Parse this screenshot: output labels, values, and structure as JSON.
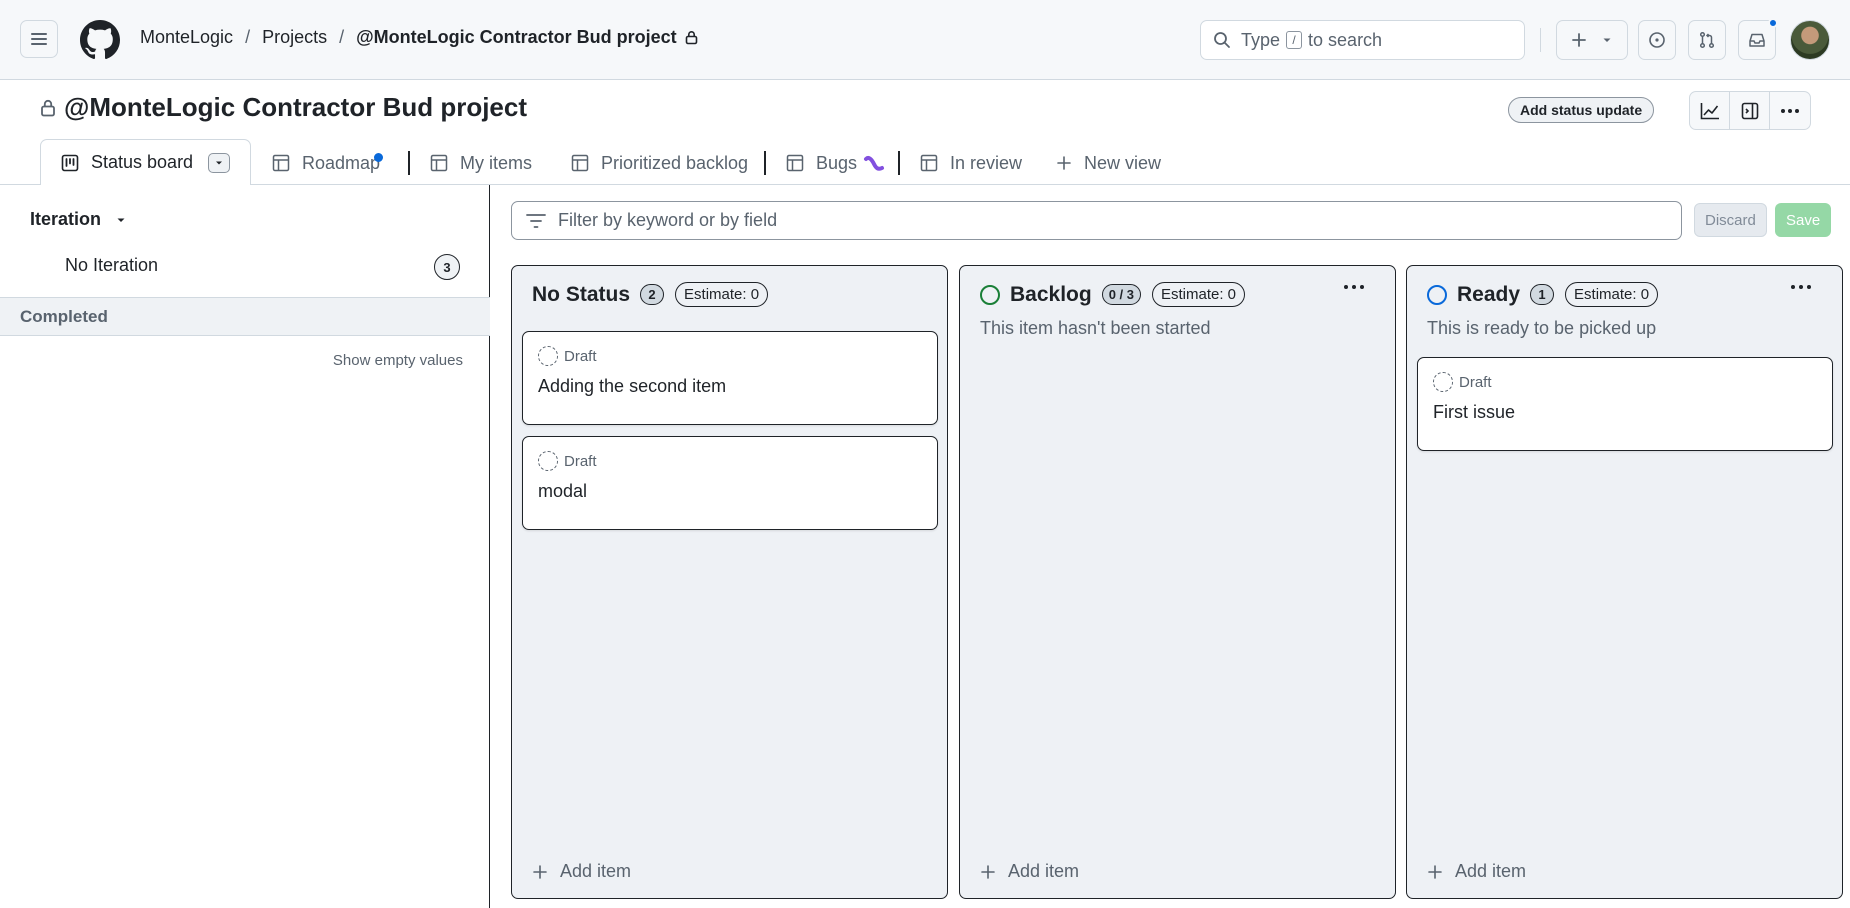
{
  "header": {
    "breadcrumbs": [
      "MonteLogic",
      "Projects",
      "@MonteLogic Contractor Bud project"
    ],
    "separator": "/",
    "search": {
      "prefix": "Type",
      "key": "/",
      "suffix": "to search"
    }
  },
  "project": {
    "title": "@MonteLogic Contractor Bud project",
    "status_update_label": "Add status update"
  },
  "tabs": [
    {
      "label": "Status board",
      "icon": "board-icon",
      "active": true
    },
    {
      "label": "Roadmap",
      "icon": "table-icon"
    },
    {
      "label": "My items",
      "icon": "table-icon"
    },
    {
      "label": "Prioritized backlog",
      "icon": "table-icon"
    },
    {
      "label": "Bugs",
      "icon": "table-icon",
      "emoji": "bug-icon"
    },
    {
      "label": "In review",
      "icon": "table-icon"
    },
    {
      "label": "New view",
      "icon": "plus-icon"
    }
  ],
  "sidebar": {
    "group_label": "Iteration",
    "items": [
      {
        "label": "No Iteration",
        "count": "3"
      }
    ],
    "completed_label": "Completed",
    "show_empty_label": "Show empty values"
  },
  "filter": {
    "placeholder": "Filter by keyword or by field",
    "discard_label": "Discard",
    "save_label": "Save"
  },
  "columns": [
    {
      "title": "No Status",
      "count": "2",
      "estimate": "Estimate: 0",
      "description": "",
      "cards": [
        {
          "status": "Draft",
          "title": "Adding the second item"
        },
        {
          "status": "Draft",
          "title": "modal"
        }
      ],
      "add_label": "Add item"
    },
    {
      "title": "Backlog",
      "count": "0 / 3",
      "estimate": "Estimate: 0",
      "description": "This item hasn't been started",
      "status_color": "#1a7f37",
      "cards": [],
      "add_label": "Add item"
    },
    {
      "title": "Ready",
      "count": "1",
      "estimate": "Estimate: 0",
      "description": "This is ready to be picked up",
      "status_color": "#0969da",
      "cards": [
        {
          "status": "Draft",
          "title": "First issue"
        }
      ],
      "add_label": "Add item"
    }
  ],
  "colors": {
    "accent": "#0969da",
    "success": "#1a7f37",
    "save_disabled": "#95d8a6",
    "column_bg": "#eef1f5",
    "bug_emoji": "#8250df"
  }
}
